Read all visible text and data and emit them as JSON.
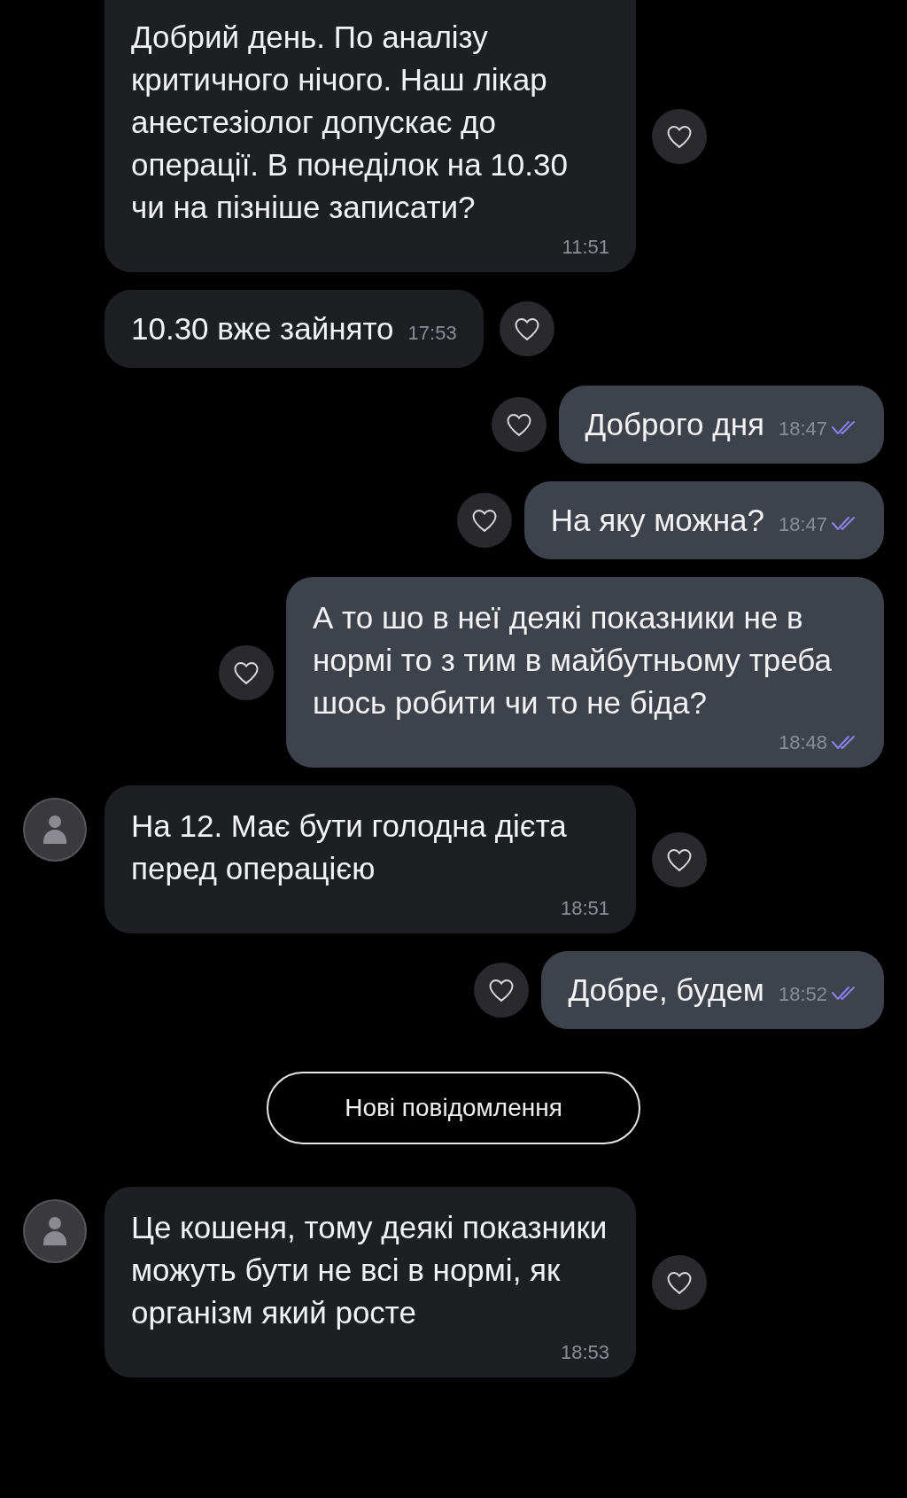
{
  "messages": [
    {
      "kind": "incoming",
      "inline_time": false,
      "avatar": false,
      "text": "Добрий день. По аналізу критичного нічого. Наш лікар анестезіолог допускає до операції. В понеділок на 10.30 чи на пізніше записати?",
      "time": "11:51"
    },
    {
      "kind": "incoming",
      "inline_time": true,
      "avatar": false,
      "text": "10.30 вже зайнято",
      "time": "17:53"
    },
    {
      "kind": "outgoing",
      "inline_time": true,
      "text": "Доброго дня",
      "time": "18:47"
    },
    {
      "kind": "outgoing",
      "inline_time": true,
      "text": "На яку можна?",
      "time": "18:47"
    },
    {
      "kind": "outgoing",
      "inline_time": false,
      "text": "А то шо в неї деякі показники не в нормі то з тим в майбутньому треба шось робити чи то не біда?",
      "time": "18:48"
    },
    {
      "kind": "incoming",
      "inline_time": false,
      "avatar": true,
      "text": "На 12. Має бути голодна дієта перед операцією",
      "time": "18:51"
    },
    {
      "kind": "outgoing",
      "inline_time": true,
      "text": "Добре, будем",
      "time": "18:52"
    },
    {
      "kind": "divider",
      "text": "Нові повідомлення"
    },
    {
      "kind": "incoming",
      "inline_time": false,
      "avatar": true,
      "text": "Це кошеня, тому деякі показники можуть бути не всі в нормі, як організм який росте",
      "time": "18:53"
    }
  ]
}
